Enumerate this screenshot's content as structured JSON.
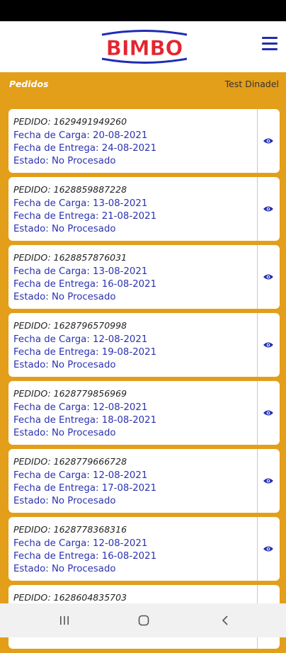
{
  "header": {
    "logo_text": "BIMBO"
  },
  "subheader": {
    "section": "Pedidos",
    "user": "Test Dinadel"
  },
  "orders": [
    {
      "id": "PEDIDO: 1629491949260",
      "carga": "Fecha de Carga: 20-08-2021",
      "entrega": "Fecha de Entrega: 24-08-2021",
      "estado": "Estado: No Procesado"
    },
    {
      "id": "PEDIDO: 1628859887228",
      "carga": "Fecha de Carga: 13-08-2021",
      "entrega": "Fecha de Entrega: 21-08-2021",
      "estado": "Estado: No Procesado"
    },
    {
      "id": "PEDIDO: 1628857876031",
      "carga": "Fecha de Carga: 13-08-2021",
      "entrega": "Fecha de Entrega: 16-08-2021",
      "estado": "Estado: No Procesado"
    },
    {
      "id": "PEDIDO: 1628796570998",
      "carga": "Fecha de Carga: 12-08-2021",
      "entrega": "Fecha de Entrega: 19-08-2021",
      "estado": "Estado: No Procesado"
    },
    {
      "id": "PEDIDO: 1628779856969",
      "carga": "Fecha de Carga: 12-08-2021",
      "entrega": "Fecha de Entrega: 18-08-2021",
      "estado": "Estado: No Procesado"
    },
    {
      "id": "PEDIDO: 1628779666728",
      "carga": "Fecha de Carga: 12-08-2021",
      "entrega": "Fecha de Entrega: 17-08-2021",
      "estado": "Estado: No Procesado"
    },
    {
      "id": "PEDIDO: 1628778368316",
      "carga": "Fecha de Carga: 12-08-2021",
      "entrega": "Fecha de Entrega: 16-08-2021",
      "estado": "Estado: No Procesado"
    },
    {
      "id": "PEDIDO: 1628604835703",
      "carga": "",
      "entrega": "",
      "estado": ""
    }
  ],
  "icons": {
    "menu": "hamburger-menu-icon",
    "view": "eye-icon",
    "recents": "recents-icon",
    "home": "home-icon",
    "back": "back-icon"
  },
  "colors": {
    "accent": "#e39e1a",
    "text_blue": "#2b32b0",
    "brand_red": "#e4252f",
    "brand_blue": "#1f2db3"
  }
}
